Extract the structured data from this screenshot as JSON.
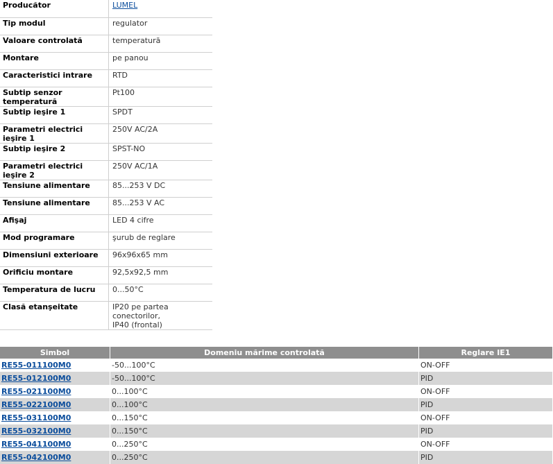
{
  "specs": {
    "rows": [
      {
        "label": "Producător",
        "value": "LUMEL",
        "link": true
      },
      {
        "label": "Tip modul",
        "value": "regulator"
      },
      {
        "label": "Valoare controlată",
        "value": "temperatură"
      },
      {
        "label": "Montare",
        "value": "pe panou"
      },
      {
        "label": "Caracteristici intrare",
        "value": "RTD"
      },
      {
        "label": "Subtip senzor temperatură",
        "value": "Pt100"
      },
      {
        "label": "Subtip ieşire 1",
        "value": "SPDT"
      },
      {
        "label": "Parametri electrici ieşire 1",
        "value": "250V AC/2A"
      },
      {
        "label": "Subtip ieşire 2",
        "value": "SPST-NO"
      },
      {
        "label": "Parametri electrici ieşire 2",
        "value": "250V AC/1A"
      },
      {
        "label": "Tensiune alimentare",
        "value": "85...253 V DC"
      },
      {
        "label": "Tensiune alimentare",
        "value": "85...253 V AC"
      },
      {
        "label": "Afişaj",
        "value": "LED 4 cifre"
      },
      {
        "label": "Mod programare",
        "value": "şurub de reglare"
      },
      {
        "label": "Dimensiuni exterioare",
        "value": "96x96x65 mm"
      },
      {
        "label": "Orificiu montare",
        "value": "92,5x92,5 mm"
      },
      {
        "label": "Temperatura de lucru",
        "value": "0...50°C"
      },
      {
        "label": "Clasă etanşeitate",
        "value": "IP20 pe partea conectorilor,",
        "value2": "IP40 (frontal)"
      }
    ]
  },
  "models": {
    "headers": [
      "Simbol",
      "Domeniu mărime controlată",
      "Reglare IE1"
    ],
    "rows": [
      [
        "RE55-011100M0",
        "-50...100°C",
        "ON-OFF"
      ],
      [
        "RE55-012100M0",
        "-50...100°C",
        "PID"
      ],
      [
        "RE55-021100M0",
        "0...100°C",
        "ON-OFF"
      ],
      [
        "RE55-022100M0",
        "0...100°C",
        "PID"
      ],
      [
        "RE55-031100M0",
        "0...150°C",
        "ON-OFF"
      ],
      [
        "RE55-032100M0",
        "0...150°C",
        "PID"
      ],
      [
        "RE55-041100M0",
        "0...250°C",
        "ON-OFF"
      ],
      [
        "RE55-042100M0",
        "0...250°C",
        "PID"
      ]
    ]
  }
}
